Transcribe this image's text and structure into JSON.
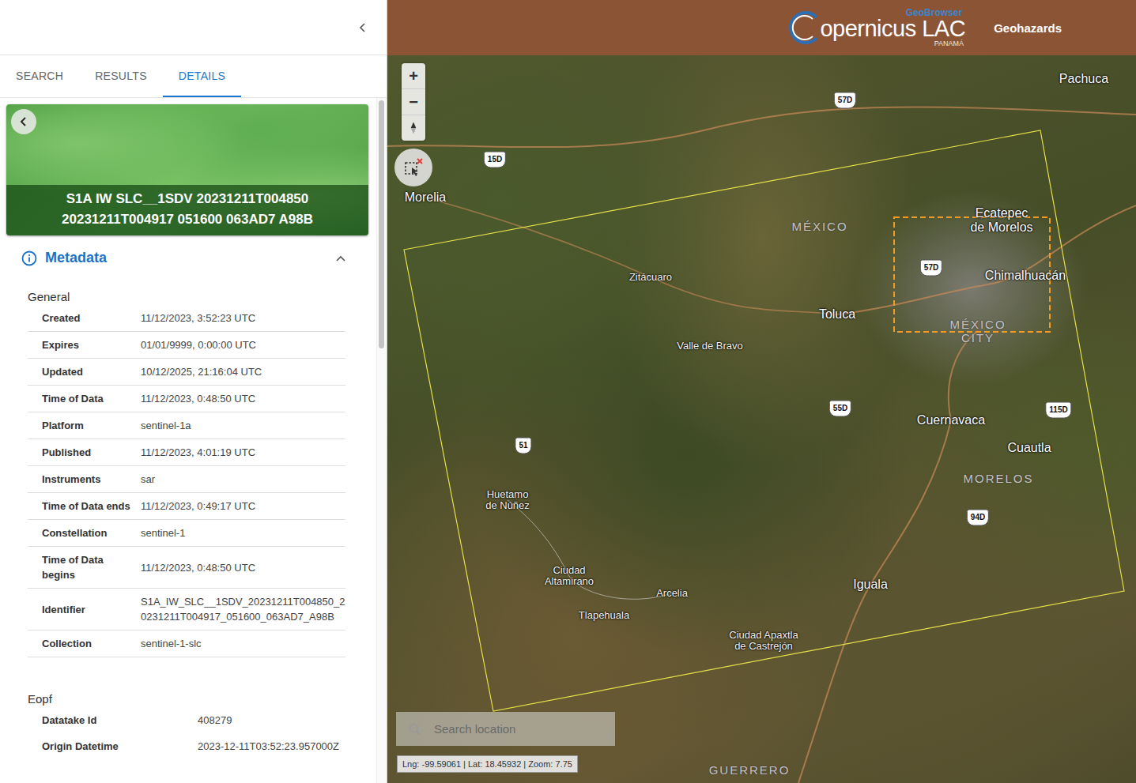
{
  "sidebar": {
    "tabs": [
      {
        "label": "SEARCH",
        "selected": false
      },
      {
        "label": "RESULTS",
        "selected": false
      },
      {
        "label": "DETAILS",
        "selected": true
      }
    ],
    "product": {
      "title_lines": [
        "S1A IW SLC__1SDV 20231211T004850",
        "20231211T004917 051600 063AD7 A98B"
      ]
    },
    "metadata": {
      "heading": "Metadata",
      "expanded": true,
      "sections": [
        {
          "title": "General",
          "rows": [
            {
              "label": "Created",
              "value": "11/12/2023, 3:52:23 UTC"
            },
            {
              "label": "Expires",
              "value": "01/01/9999, 0:00:00 UTC"
            },
            {
              "label": "Updated",
              "value": "10/12/2025, 21:16:04 UTC"
            },
            {
              "label": "Time of Data",
              "value": "11/12/2023, 0:48:50 UTC"
            },
            {
              "label": "Platform",
              "value": "sentinel-1a"
            },
            {
              "label": "Published",
              "value": "11/12/2023, 4:01:19 UTC"
            },
            {
              "label": "Instruments",
              "value": "sar"
            },
            {
              "label": "Time of Data ends",
              "value": "11/12/2023, 0:49:17 UTC"
            },
            {
              "label": "Constellation",
              "value": "sentinel-1"
            },
            {
              "label": "Time of Data begins",
              "value": "11/12/2023, 0:48:50 UTC"
            },
            {
              "label": "Identifier",
              "value": "S1A_IW_SLC__1SDV_20231211T004850_20231211T004917_051600_063AD7_A98B"
            },
            {
              "label": "Collection",
              "value": "sentinel-1-slc"
            }
          ]
        },
        {
          "title": "Eopf",
          "rows": [
            {
              "label": "Datatake Id",
              "value": "408279"
            },
            {
              "label": "Origin Datetime",
              "value": "2023-12-11T03:52:23.957000Z"
            }
          ]
        }
      ]
    }
  },
  "header": {
    "logo_top": "GeoBrowser",
    "logo_main": "opernicus LAC",
    "logo_sub": "PANAMÁ",
    "app_name": "Geohazards"
  },
  "map": {
    "search_placeholder": "Search location",
    "coordinates": "Lng: -99.59061 | Lat: 18.45932 | Zoom: 7.75",
    "zoom_in": "+",
    "zoom_out": "−",
    "labels": [
      {
        "lines": [
          "Pachuca"
        ],
        "kind": "city"
      },
      {
        "lines": [
          "Morelia"
        ],
        "kind": "city"
      },
      {
        "lines": [
          "MÉXICO"
        ],
        "kind": "region"
      },
      {
        "lines": [
          "Ecatepec",
          "de Morelos"
        ],
        "kind": "city"
      },
      {
        "lines": [
          "Chimalhuacán"
        ],
        "kind": "city"
      },
      {
        "lines": [
          "Zitácuaro"
        ],
        "kind": "town"
      },
      {
        "lines": [
          "Toluca"
        ],
        "kind": "city"
      },
      {
        "lines": [
          "MÉXICO",
          "CITY"
        ],
        "kind": "region"
      },
      {
        "lines": [
          "Valle de Bravo"
        ],
        "kind": "town"
      },
      {
        "lines": [
          "Cuernavaca"
        ],
        "kind": "city"
      },
      {
        "lines": [
          "Cuautla"
        ],
        "kind": "city"
      },
      {
        "lines": [
          "MORELOS"
        ],
        "kind": "region"
      },
      {
        "lines": [
          "Huetamo",
          "de Núñez"
        ],
        "kind": "town"
      },
      {
        "lines": [
          "Ciudad",
          "Altamirano"
        ],
        "kind": "town"
      },
      {
        "lines": [
          "Arcelia"
        ],
        "kind": "town"
      },
      {
        "lines": [
          "Iguala"
        ],
        "kind": "city"
      },
      {
        "lines": [
          "Tlapehuala"
        ],
        "kind": "town"
      },
      {
        "lines": [
          "Ciudad Apaxtla",
          "de Castrejón"
        ],
        "kind": "town"
      },
      {
        "lines": [
          "GUERRERO"
        ],
        "kind": "region"
      },
      {
        "lines": [
          "57D"
        ],
        "kind": "shield"
      },
      {
        "lines": [
          "15D"
        ],
        "kind": "shield"
      },
      {
        "lines": [
          "57D"
        ],
        "kind": "shield"
      },
      {
        "lines": [
          "55D"
        ],
        "kind": "shield"
      },
      {
        "lines": [
          "51"
        ],
        "kind": "shield"
      },
      {
        "lines": [
          "115D"
        ],
        "kind": "shield"
      },
      {
        "lines": [
          "94D"
        ],
        "kind": "shield"
      }
    ]
  }
}
